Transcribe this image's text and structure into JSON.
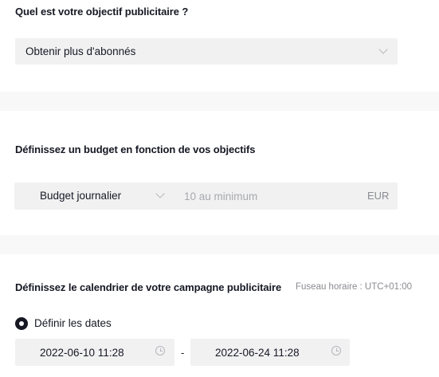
{
  "objective": {
    "heading": "Quel est votre objectif publicitaire ?",
    "selected": "Obtenir plus d'abonnés"
  },
  "budget": {
    "heading": "Définissez un budget en fonction de vos objectifs",
    "type_selected": "Budget journalier",
    "amount_placeholder": "10 au minimum",
    "currency": "EUR"
  },
  "schedule": {
    "heading": "Définissez le calendrier de votre campagne publicitaire",
    "timezone": "Fuseau horaire : UTC+01:00",
    "radio_label": "Définir les dates",
    "start_date": "2022-06-10 11:28",
    "separator": "-",
    "end_date": "2022-06-24 11:28"
  },
  "icons": {
    "dropdown": "chevron-down-icon",
    "time": "clock-icon"
  },
  "colors": {
    "text": "#161823",
    "field_bg": "#f1f1f2",
    "section_divider": "#f8f8f8",
    "placeholder": "#a8a9ad"
  }
}
